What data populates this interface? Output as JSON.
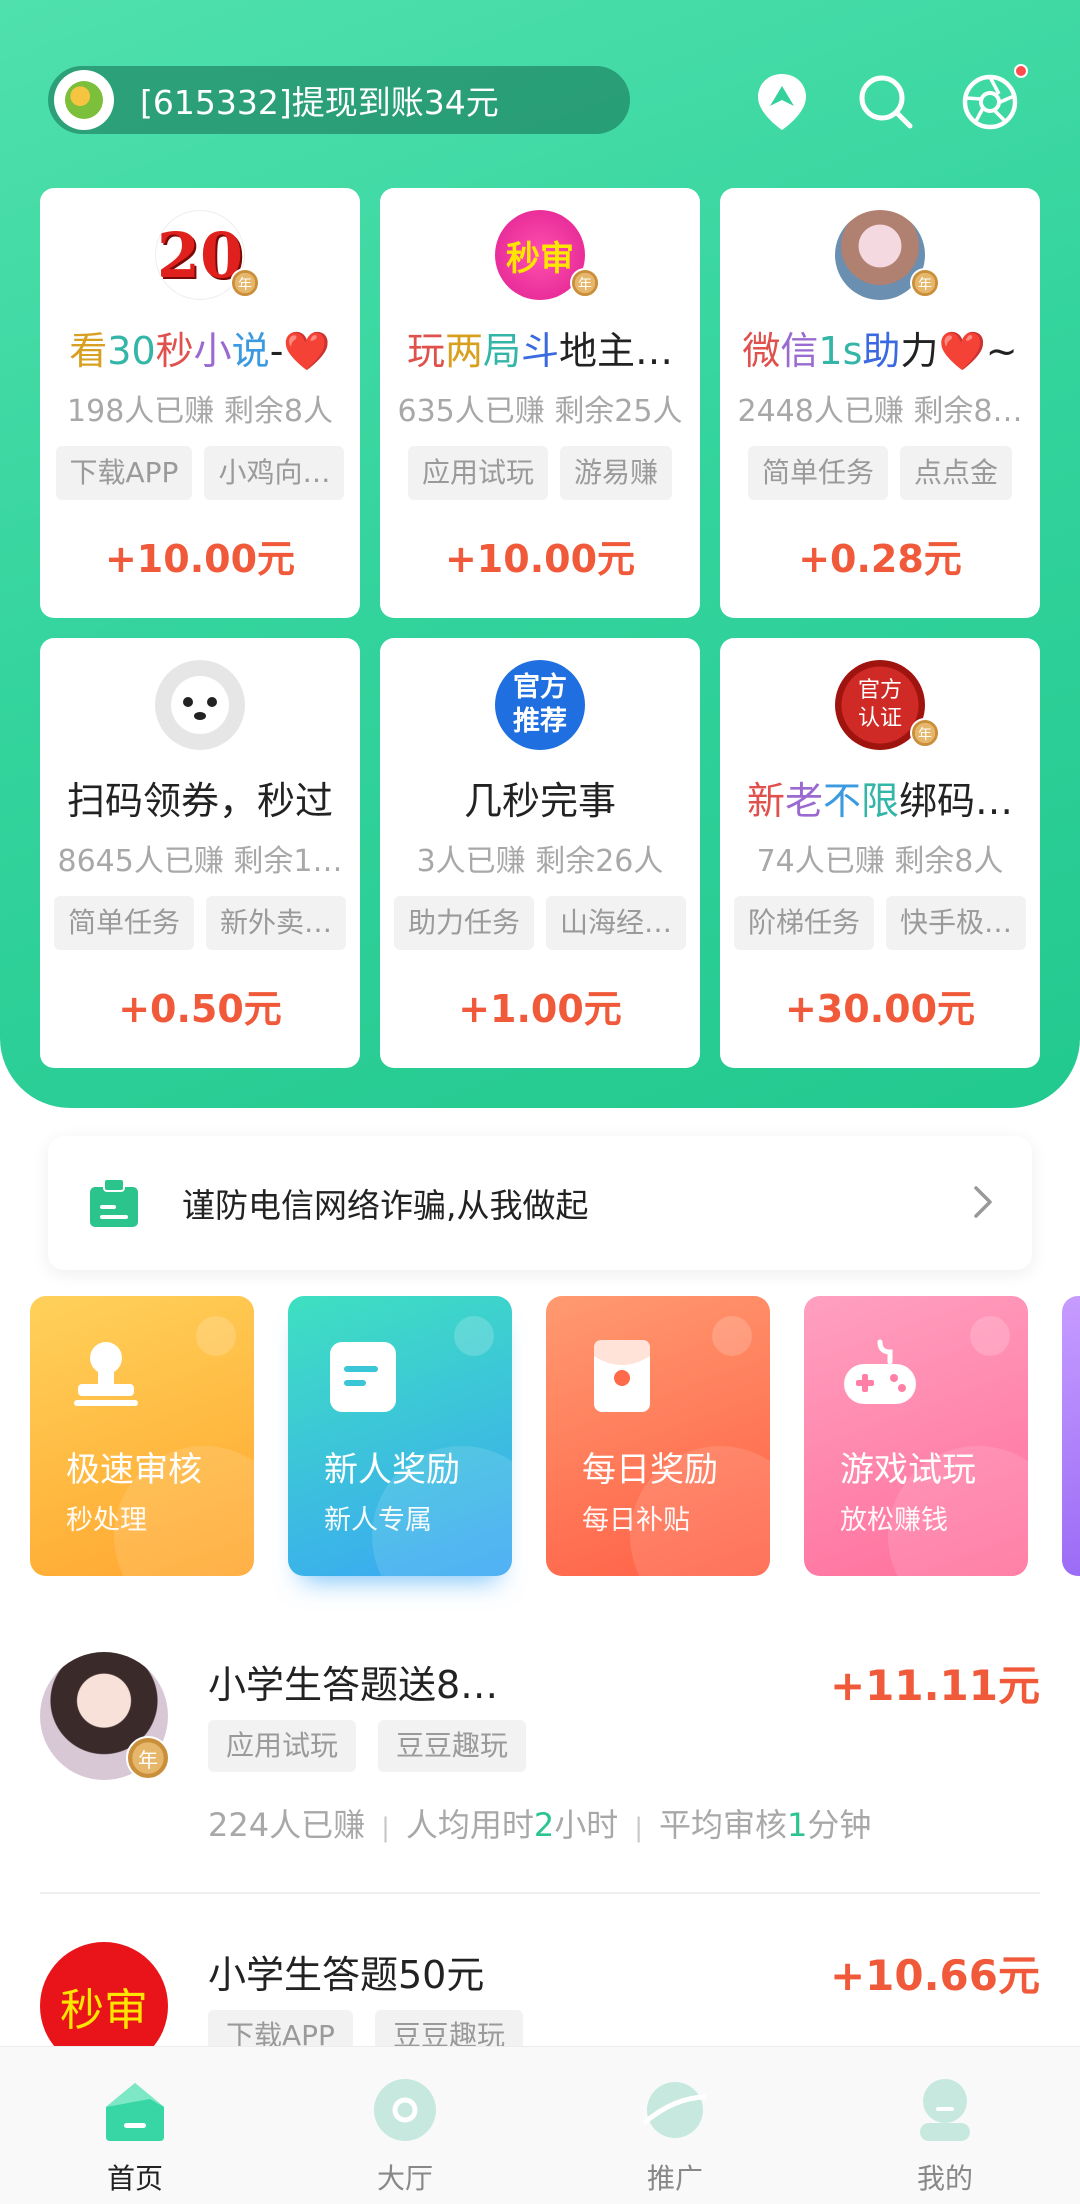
{
  "header": {
    "ticker_text": "[615332]提现到账34元",
    "icons": [
      "location-pin-icon",
      "search-icon",
      "camera-shutter-icon"
    ]
  },
  "cards": [
    {
      "avatar_text": "20",
      "title_parts": [
        {
          "t": "看",
          "c": "#d8a020"
        },
        {
          "t": "30",
          "c": "#33b5a8"
        },
        {
          "t": "秒",
          "c": "#e0504c"
        },
        {
          "t": "小",
          "c": "#9b6ad0"
        },
        {
          "t": "说",
          "c": "#3b9ae0"
        },
        {
          "t": "-",
          "c": "#222"
        },
        {
          "t": "❤️",
          "c": "#e0302c"
        }
      ],
      "earned": "198人已赚",
      "remaining": "剩余8人",
      "tags": [
        "下载APP",
        "小鸡向…"
      ],
      "reward": "+10.00元"
    },
    {
      "avatar_text": "秒审",
      "title_parts": [
        {
          "t": "玩",
          "c": "#e0504c"
        },
        {
          "t": "两",
          "c": "#d8a020"
        },
        {
          "t": "局",
          "c": "#33b5a8"
        },
        {
          "t": "斗",
          "c": "#3b6ae0"
        },
        {
          "t": "地主…",
          "c": "#222"
        }
      ],
      "earned": "635人已赚",
      "remaining": "剩余25人",
      "tags": [
        "应用试玩",
        "游易赚"
      ],
      "reward": "+10.00元"
    },
    {
      "avatar_text": "",
      "title_parts": [
        {
          "t": "微",
          "c": "#e0504c"
        },
        {
          "t": "信",
          "c": "#9b6ad0"
        },
        {
          "t": "1s",
          "c": "#33b5a8"
        },
        {
          "t": "助",
          "c": "#3b6ae0"
        },
        {
          "t": "力",
          "c": "#222"
        },
        {
          "t": "❤️",
          "c": "#e0302c"
        },
        {
          "t": "~",
          "c": "#222"
        }
      ],
      "earned": "2448人已赚",
      "remaining": "剩余8…",
      "tags": [
        "简单任务",
        "点点金"
      ],
      "reward": "+0.28元"
    },
    {
      "avatar_text": "",
      "title_parts": [
        {
          "t": "扫码领券，秒过",
          "c": "#222"
        }
      ],
      "earned": "8645人已赚",
      "remaining": "剩余1…",
      "tags": [
        "简单任务",
        "新外卖…"
      ],
      "reward": "+0.50元"
    },
    {
      "avatar_text": "官方推荐",
      "title_parts": [
        {
          "t": "几秒完事",
          "c": "#222"
        }
      ],
      "earned": "3人已赚",
      "remaining": "剩余26人",
      "tags": [
        "助力任务",
        "山海经…"
      ],
      "reward": "+1.00元"
    },
    {
      "avatar_text": "官方认证",
      "title_parts": [
        {
          "t": "新",
          "c": "#e0504c"
        },
        {
          "t": "老",
          "c": "#9b6ad0"
        },
        {
          "t": "不",
          "c": "#3b9ae0"
        },
        {
          "t": "限",
          "c": "#33b5a8"
        },
        {
          "t": "绑码…",
          "c": "#222"
        }
      ],
      "earned": "74人已赚",
      "remaining": "剩余8人",
      "tags": [
        "阶梯任务",
        "快手极…"
      ],
      "reward": "+30.00元"
    }
  ],
  "notice": {
    "text": "谨防电信网络诈骗,从我做起"
  },
  "tiles": [
    {
      "title": "极速审核",
      "sub": "秒处理",
      "colors": [
        "#ffd15a",
        "#ffa62e"
      ],
      "icon": "stamp-icon"
    },
    {
      "title": "新人奖励",
      "sub": "新人专属",
      "colors": [
        "#3ee0c0",
        "#3aa6f5"
      ],
      "icon": "note-icon"
    },
    {
      "title": "每日奖励",
      "sub": "每日补贴",
      "colors": [
        "#ff9a70",
        "#ff5f45"
      ],
      "icon": "red-envelope-icon"
    },
    {
      "title": "游戏试玩",
      "sub": "放松赚钱",
      "colors": [
        "#ffa0c0",
        "#ff6f9c"
      ],
      "icon": "gamepad-icon"
    }
  ],
  "list": [
    {
      "title": "小学生答题送8…",
      "reward": "+11.11元",
      "tags": [
        "应用试玩",
        "豆豆趣玩"
      ],
      "earned": "224人已赚",
      "time_prefix": "人均用时",
      "time_num": "2",
      "time_unit": "小时",
      "review_prefix": "平均审核",
      "review_num": "1",
      "review_unit": "分钟"
    },
    {
      "title": "小学生答题50元",
      "reward": "+10.66元",
      "tags": [
        "下载APP",
        "豆豆趣玩"
      ],
      "avatar_text": "秒审"
    }
  ],
  "nav": [
    {
      "label": "首页",
      "icon": "home-icon",
      "active": true
    },
    {
      "label": "大厅",
      "icon": "hall-icon",
      "active": false
    },
    {
      "label": "推广",
      "icon": "planet-icon",
      "active": false
    },
    {
      "label": "我的",
      "icon": "profile-icon",
      "active": false
    }
  ],
  "colors": {
    "accent_green": "#2bc48d",
    "reward_red": "#f05a3a"
  }
}
